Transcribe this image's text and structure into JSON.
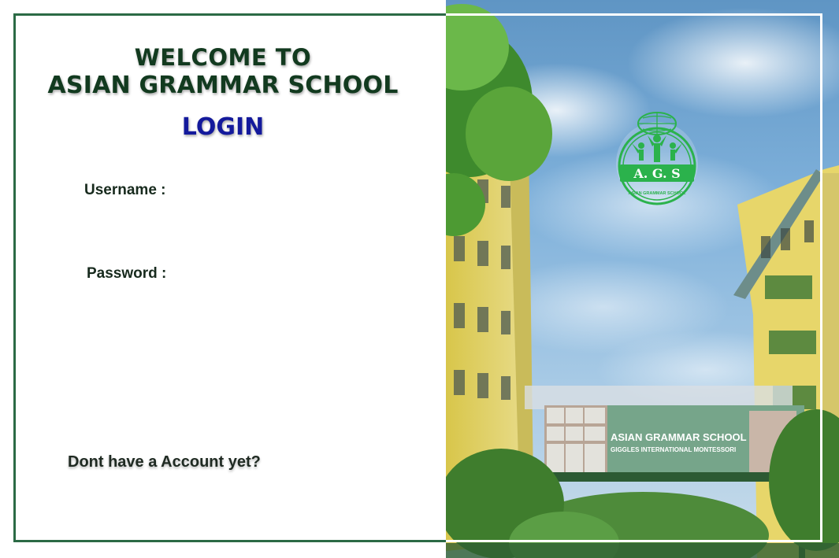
{
  "heading": {
    "welcome_line1": "WELCOME TO",
    "welcome_line2": "ASIAN GRAMMAR SCHOOL",
    "login_title": "LOGIN"
  },
  "form": {
    "username_label": "Username :",
    "password_label": "Password :",
    "signup_prompt": "Dont have a Account yet?"
  },
  "photo": {
    "logo_badge_text": "A. G. S",
    "logo_ring_text": "ASIAN GRAMMAR SCHOOL",
    "sign_line1": "ASIAN GRAMMAR SCHOOL",
    "sign_line2": "GIGGLES INTERNATIONAL MONTESSORI"
  },
  "colors": {
    "frame_border": "#2b6a45",
    "heading_text": "#123a1f",
    "login_text": "#141a9c",
    "logo_green": "#2bb24c"
  }
}
